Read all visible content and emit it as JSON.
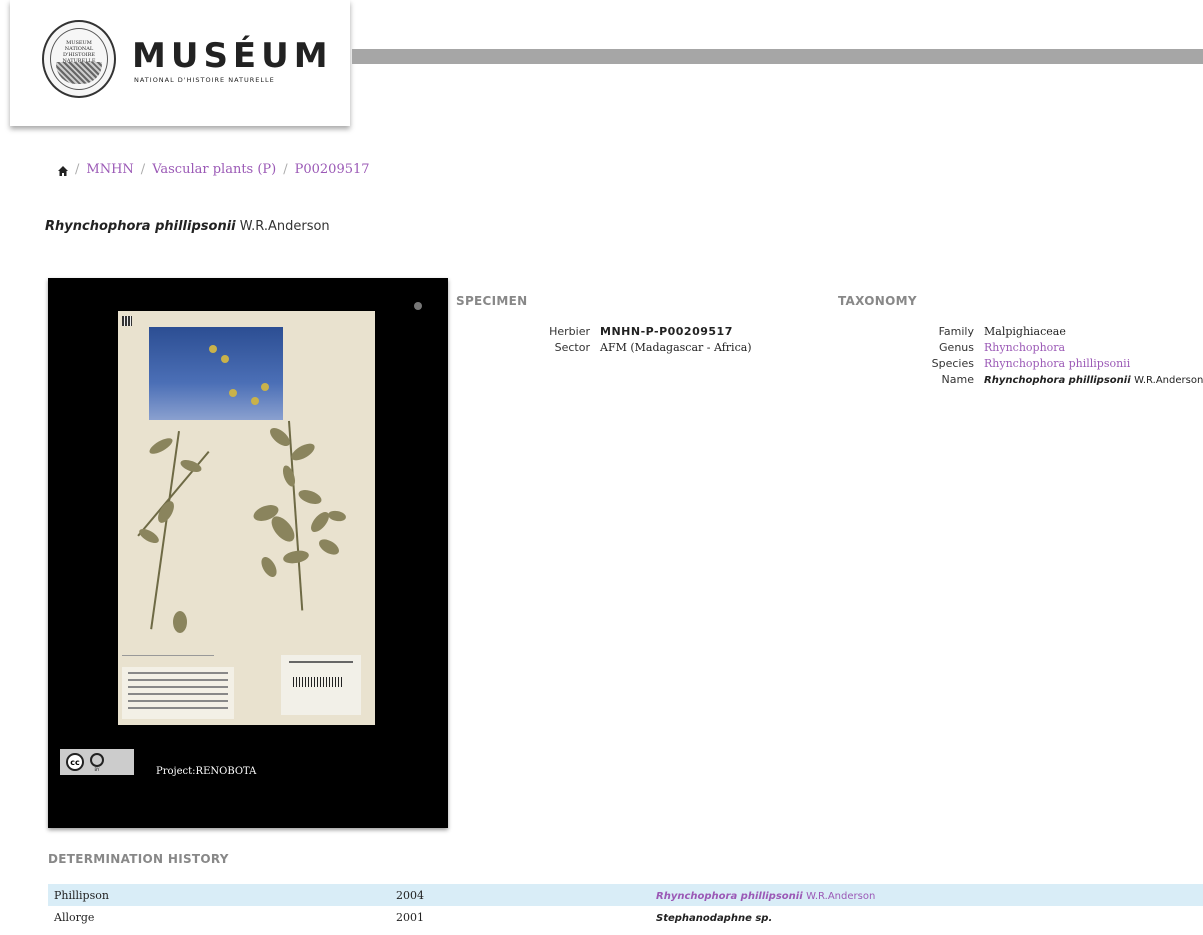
{
  "header": {
    "brand": "MUSÉUM",
    "brand_sub": "NATIONAL D'HISTOIRE NATURELLE",
    "seal_text": "MUSEUM NATIONAL D'HISTOIRE NATURELLE"
  },
  "breadcrumb": {
    "home_icon": "home-icon",
    "items": [
      "MNHN",
      "Vascular plants (P)",
      "P00209517"
    ],
    "separator": "/"
  },
  "title": {
    "scientific": "Rhynchophora phillipsonii",
    "author": "W.R.Anderson"
  },
  "image": {
    "license_cc": "cc",
    "license_by": "BY",
    "project": "Project:RENOBOTA"
  },
  "specimen": {
    "heading": "SPECIMEN",
    "rows": [
      {
        "label": "Herbier",
        "value": "MNHN-P-P00209517"
      },
      {
        "label": "Sector",
        "value": "AFM (Madagascar - Africa)"
      }
    ]
  },
  "taxonomy": {
    "heading": "TAXONOMY",
    "family_label": "Family",
    "family": "Malpighiaceae",
    "genus_label": "Genus",
    "genus": "Rhynchophora",
    "species_label": "Species",
    "species": "Rhynchophora phillipsonii",
    "name_label": "Name",
    "name_sci": "Rhynchophora phillipsonii",
    "name_author": "W.R.Anderson"
  },
  "determination": {
    "heading": "DETERMINATION HISTORY",
    "rows": [
      {
        "who": "Phillipson",
        "year": "2004",
        "name": "Rhynchophora phillipsonii",
        "author": "W.R.Anderson"
      },
      {
        "who": "Allorge",
        "year": "2001",
        "name": "Stephanodaphne sp.",
        "author": ""
      }
    ]
  },
  "colors": {
    "link": "#9b59b6",
    "header_bar": "#a6a6a6",
    "row_highlight": "#d9edf7"
  }
}
